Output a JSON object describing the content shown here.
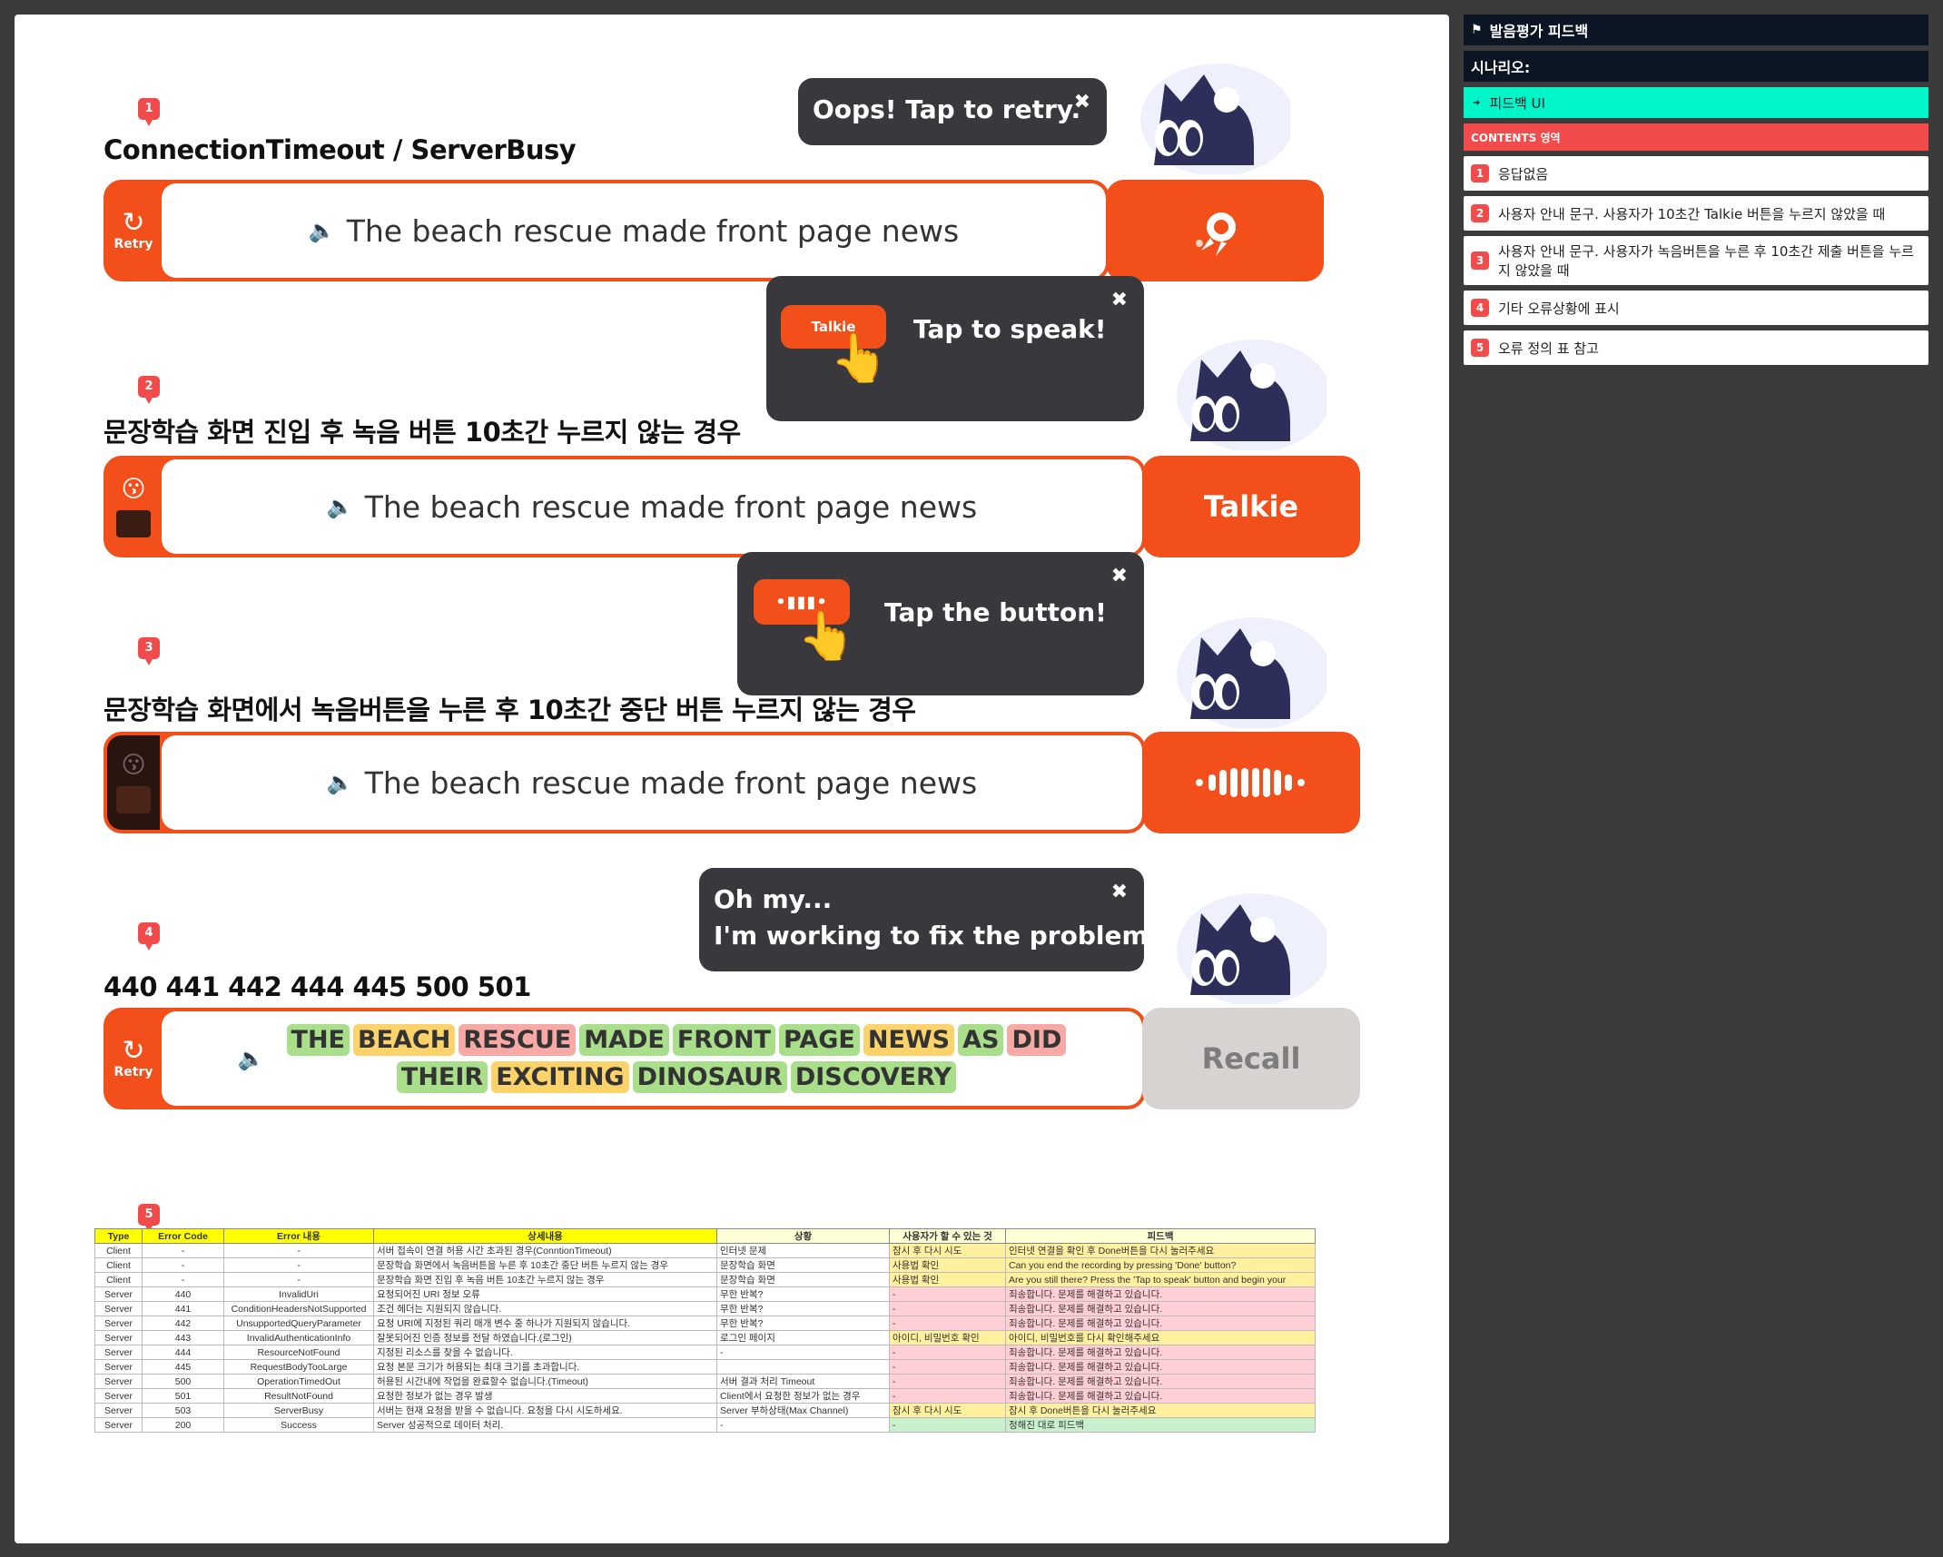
{
  "panel": {
    "header": "발음평가 피드백",
    "scenario_label": "시나리오:",
    "feedback_ui_label": "피드백 UI",
    "contents_label": "CONTENTS 영역",
    "items": [
      {
        "num": "1",
        "text": "응답없음"
      },
      {
        "num": "2",
        "text": "사용자 안내 문구. 사용자가 10초간 Talkie 버튼을 누르지 않았을 때"
      },
      {
        "num": "3",
        "text": "사용자 안내 문구. 사용자가 녹음버튼을 누른 후 10초간 제출 버튼을 누르지 않았을 때"
      },
      {
        "num": "4",
        "text": "기타 오류상황에 표시"
      },
      {
        "num": "5",
        "text": "오류 정의 표 참고"
      }
    ]
  },
  "sections": [
    {
      "badge": "1",
      "title": "ConnectionTimeout / ServerBusy",
      "sentence": "The beach rescue made front page news",
      "side_label": "Retry",
      "bubble_text": "Oops! Tap to retry.",
      "close": "✖"
    },
    {
      "badge": "2",
      "title": "문장학습 화면 진입 후 녹음 버튼 10초간 누르지 않는 경우",
      "sentence": "The beach rescue made front page news",
      "action_label": "Talkie",
      "bubble_text": "Tap to speak!",
      "mini_button": "Talkie",
      "close": "✖"
    },
    {
      "badge": "3",
      "title": "문장학습 화면에서 녹음버튼을 누른 후 10초간 중단 버튼 누르지 않는 경우",
      "sentence": "The beach rescue made front page news",
      "bubble_text": "Tap the button!",
      "close": "✖"
    },
    {
      "badge": "4",
      "title": "440 441 442 444 445 500 501",
      "side_label": "Retry",
      "action_label": "Recall",
      "bubble_line1": "Oh my...",
      "bubble_line2": "I'm working to fix the problem.",
      "close": "✖",
      "words_row1": [
        {
          "w": "THE",
          "c": "green"
        },
        {
          "w": "BEACH",
          "c": "yellow"
        },
        {
          "w": "RESCUE",
          "c": "red"
        },
        {
          "w": "MADE",
          "c": "green"
        },
        {
          "w": "FRONT",
          "c": "green"
        },
        {
          "w": "PAGE",
          "c": "green"
        },
        {
          "w": "NEWS",
          "c": "yellow"
        },
        {
          "w": "AS",
          "c": "green"
        },
        {
          "w": "DID",
          "c": "red"
        }
      ],
      "words_row2": [
        {
          "w": "THEIR",
          "c": "green"
        },
        {
          "w": "EXCITING",
          "c": "yellow"
        },
        {
          "w": "DINOSAUR",
          "c": "green"
        },
        {
          "w": "DISCOVERY",
          "c": "green"
        }
      ]
    },
    {
      "badge": "5"
    }
  ],
  "table": {
    "headers": [
      "Type",
      "Error Code",
      "Error 내용",
      "상세내용",
      "상황",
      "사용자가 할 수 있는 것",
      "피드백"
    ],
    "rows": [
      [
        "Client",
        "-",
        "-",
        "서버 접속이 연결 허용 시간 초과된 경우(ConntionTimeout)",
        "인터넷 문제",
        "잠시 후 다시 시도",
        "인터넷 연결을 확인 후 Done버튼을 다시 눌러주세요"
      ],
      [
        "Client",
        "-",
        "-",
        "문장학습 화면에서 녹음버튼을 누른 후 10초간 중단 버튼 누르지 않는 경우",
        "문장학습 화면",
        "사용법 확인",
        "Can you end the recording by pressing 'Done' button?"
      ],
      [
        "Client",
        "-",
        "-",
        "문장학습 화면 진입 후 녹음 버튼 10초간 누르지 않는 경우",
        "문장학습 화면",
        "사용법 확인",
        "Are you still there? Press the 'Tap to speak' button and begin your"
      ],
      [
        "Server",
        "440",
        "InvalidUri",
        "요청되어진 URI 정보 오류",
        "무한 반복?",
        "-",
        "죄송합니다. 문제를 해결하고 있습니다."
      ],
      [
        "Server",
        "441",
        "ConditionHeadersNotSupported",
        "조건 헤더는 지원되지 않습니다.",
        "무한 반복?",
        "-",
        "죄송합니다. 문제를 해결하고 있습니다."
      ],
      [
        "Server",
        "442",
        "UnsupportedQueryParameter",
        "요청 URI에 지정된 쿼리 매개 변수 중 하나가 지원되지 않습니다.",
        "무한 반복?",
        "-",
        "죄송합니다. 문제를 해결하고 있습니다."
      ],
      [
        "Server",
        "443",
        "InvalidAuthenticationInfo",
        "잘못되어진 인증 정보를 전달 하였습니다.(로그인)",
        "로그인 페이지",
        "아이디, 비밀번호 확인",
        "아이디, 비밀번호를 다시 확인해주세요"
      ],
      [
        "Server",
        "444",
        "ResourceNotFound",
        "지정된 리소스를 찾을 수 없습니다.",
        "-",
        "-",
        "죄송합니다. 문제를 해결하고 있습니다."
      ],
      [
        "Server",
        "445",
        "RequestBodyTooLarge",
        "요청 본문 크기가 허용되는 최대 크기를 초과합니다.",
        "",
        "-",
        "죄송합니다. 문제를 해결하고 있습니다."
      ],
      [
        "Server",
        "500",
        "OperationTimedOut",
        "허용된 시간내에 작업을 완료할수 없습니다.(Timeout)",
        "서버 결과 처리 Timeout",
        "-",
        "죄송합니다. 문제를 해결하고 있습니다."
      ],
      [
        "Server",
        "501",
        "ResultNotFound",
        "요청한 정보가 없는 경우 발생",
        "Client에서 요청한 정보가 없는 경우",
        "-",
        "죄송합니다. 문제를 해결하고 있습니다."
      ],
      [
        "Server",
        "503",
        "ServerBusy",
        "서버는 현재 요청을 받을 수 없습니다. 요청을 다시 시도하세요.",
        "Server 부하상태(Max Channel)",
        "잠시 후 다시 시도",
        "잠시 후 Done버튼을 다시 눌러주세요"
      ],
      [
        "Server",
        "200",
        "Success",
        "Server 성공적으로 데이터 처리.",
        "-",
        "-",
        "정해진 대로 피드백"
      ]
    ],
    "row_styles": [
      {
        "detail": "red",
        "sit": "red",
        "can": "yel",
        "fb": "yel"
      },
      {
        "detail": "red",
        "sit": "red",
        "can": "yel",
        "fb": "yel"
      },
      {
        "detail": "red",
        "sit": "red",
        "can": "yel",
        "fb": "yel"
      },
      {
        "detail": "",
        "sit": "red",
        "can": "pink",
        "fb": "pink"
      },
      {
        "detail": "",
        "sit": "red",
        "can": "pink",
        "fb": "pink"
      },
      {
        "detail": "",
        "sit": "red",
        "can": "pink",
        "fb": "pink"
      },
      {
        "detail": "",
        "sit": "",
        "can": "yel",
        "fb": "yel"
      },
      {
        "detail": "",
        "sit": "",
        "can": "pink",
        "fb": "pink"
      },
      {
        "detail": "",
        "sit": "",
        "can": "pink",
        "fb": "pink"
      },
      {
        "detail": "",
        "sit": "",
        "can": "pink",
        "fb": "pink"
      },
      {
        "detail": "",
        "sit": "",
        "can": "pink",
        "fb": "pink"
      },
      {
        "detail": "",
        "sit": "",
        "can": "yel",
        "fb": "yel"
      },
      {
        "detail": "",
        "sit": "",
        "can": "grn",
        "fb": "grn"
      }
    ]
  },
  "colors": {
    "accent": "#f24f1a",
    "bubble": "#39393d",
    "badge": "#f24b4b",
    "panel_dark": "#0c1524",
    "panel_teal": "#00f5c8",
    "mascot_body": "#2d2f5a"
  }
}
